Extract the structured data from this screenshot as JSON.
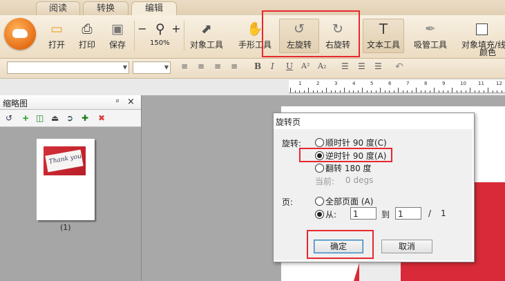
{
  "tabs": [
    "阅读",
    "转换",
    "编辑"
  ],
  "ribbon": {
    "open": "打开",
    "print": "打印",
    "save": "保存",
    "zoom_minus": "−",
    "zoom_plus": "+",
    "zoom_level": "150%",
    "object_tool": "对象工具",
    "hand_tool": "手形工具",
    "rotate_left": "左旋转",
    "rotate_right": "右旋转",
    "text_tool": "文本工具",
    "eyedropper_tool": "吸管工具",
    "fill_line": "对象填充/线",
    "color": "颜色"
  },
  "format": {
    "bold": "B",
    "italic": "I",
    "underline": "U",
    "superscript": "A²",
    "subscript": "A₂"
  },
  "ruler": {
    "numbers": [
      "1",
      "2",
      "3",
      "4",
      "5",
      "6",
      "7",
      "8",
      "9",
      "10",
      "11",
      "12"
    ]
  },
  "thumbnails": {
    "title": "缩略图",
    "pin": "ᵖ",
    "close": "×",
    "page_label": "(1)"
  },
  "dialog": {
    "title": "旋转页",
    "rotate_label": "旋转:",
    "opt_cw": "顺时针 90 度(C)",
    "opt_ccw": "逆时针 90 度(A)",
    "opt_flip": "翻转 180 度",
    "current_label": "当前:",
    "current_value": "0 degs",
    "pages_label": "页:",
    "opt_all": "全部页面 (A)",
    "opt_from": "从:",
    "from_value": "1",
    "to_label": "到",
    "to_value": "1",
    "slash": "/",
    "total": "1",
    "ok": "确定",
    "cancel": "取消"
  },
  "photo_text": "Thank you",
  "colors": {
    "annotation_red": "#e8262d",
    "ribbon_bg": "#f3e7d3",
    "logo_orange": "#e8741a"
  }
}
